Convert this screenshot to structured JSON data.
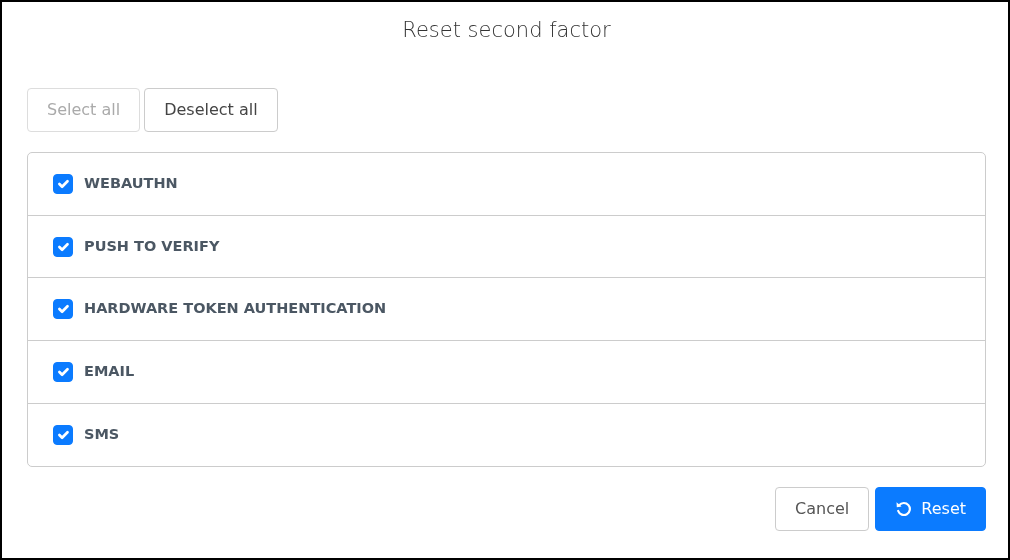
{
  "dialog": {
    "title": "Reset second factor"
  },
  "selection_buttons": [
    {
      "label": "Select all",
      "disabled": true
    },
    {
      "label": "Deselect all",
      "disabled": false
    }
  ],
  "factors": [
    {
      "label": "WEBAUTHN",
      "checked": true
    },
    {
      "label": "PUSH TO VERIFY",
      "checked": true
    },
    {
      "label": "HARDWARE TOKEN AUTHENTICATION",
      "checked": true
    },
    {
      "label": "EMAIL",
      "checked": true
    },
    {
      "label": "SMS",
      "checked": true
    }
  ],
  "footer_buttons": [
    {
      "label": "Cancel",
      "kind": "secondary"
    },
    {
      "label": "Reset",
      "kind": "primary"
    }
  ]
}
